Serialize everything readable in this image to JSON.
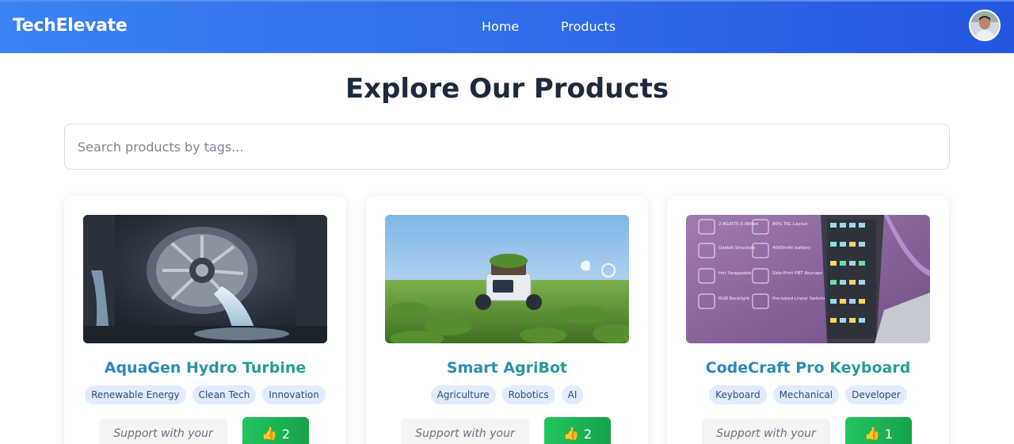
{
  "brand": "TechElevate",
  "nav": {
    "home": "Home",
    "products": "Products"
  },
  "page_title": "Explore Our Products",
  "search": {
    "placeholder": "Search products by tags..."
  },
  "products": [
    {
      "title": "AquaGen Hydro Turbine",
      "tags": [
        "Renewable Energy",
        "Clean Tech",
        "Innovation"
      ],
      "support_label": "Support with your vote!",
      "votes": "2"
    },
    {
      "title": "Smart AgriBot",
      "tags": [
        "Agriculture",
        "Robotics",
        "AI"
      ],
      "support_label": "Support with your vote!",
      "votes": "2"
    },
    {
      "title": "CodeCraft Pro Keyboard",
      "tags": [
        "Keyboard",
        "Mechanical",
        "Developer"
      ],
      "support_label": "Support with your vote!",
      "votes": "1"
    }
  ],
  "keyboard_features": [
    [
      "2.4G/BT5.0 /Wired",
      "80% TKL Layout"
    ],
    [
      "Gasket Structure",
      "4000mAh battery"
    ],
    [
      "Hot Swappable",
      "Side-Print PBT Keycaps"
    ],
    [
      "RGB Backlight",
      "Pre-lubed Linear Switches"
    ]
  ],
  "colors": {
    "navbar_start": "#3b82f6",
    "navbar_end": "#2456e0",
    "vote_button": "#22c55e",
    "tag_bg": "#e2ebfb"
  },
  "icons": {
    "vote": "thumbs-up-icon"
  }
}
